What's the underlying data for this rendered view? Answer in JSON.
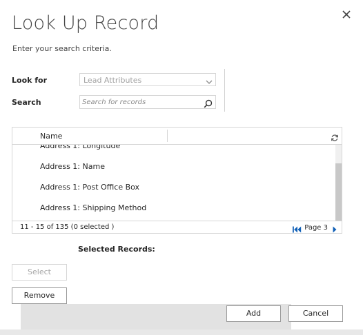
{
  "dialog": {
    "title": "Look Up Record",
    "subtitle": "Enter your search criteria."
  },
  "form": {
    "look_for_label": "Look for",
    "look_for_value": "Lead Attributes",
    "search_label": "Search",
    "search_placeholder": "Search for records",
    "search_value": ""
  },
  "grid": {
    "column_name": "Name",
    "rows": [
      {
        "name": "Address 1: Longitude"
      },
      {
        "name": "Address 1: Name"
      },
      {
        "name": "Address 1: Post Office Box"
      },
      {
        "name": "Address 1: Shipping Method"
      }
    ],
    "count_text": "11 - 15  of 135 (0 selected )",
    "page_label": "Page 3"
  },
  "selected": {
    "label": "Selected Records:"
  },
  "buttons": {
    "select": "Select",
    "remove": "Remove",
    "add": "Add",
    "cancel": "Cancel"
  },
  "icons": {
    "close": "close-icon",
    "chevron": "chevron-down-icon",
    "search": "search-icon",
    "refresh": "refresh-icon",
    "first_page": "first-page-icon",
    "next_page": "next-page-icon"
  },
  "colors": {
    "pager_accent": "#1160b7",
    "footer_bar": "#e2e2e2"
  }
}
